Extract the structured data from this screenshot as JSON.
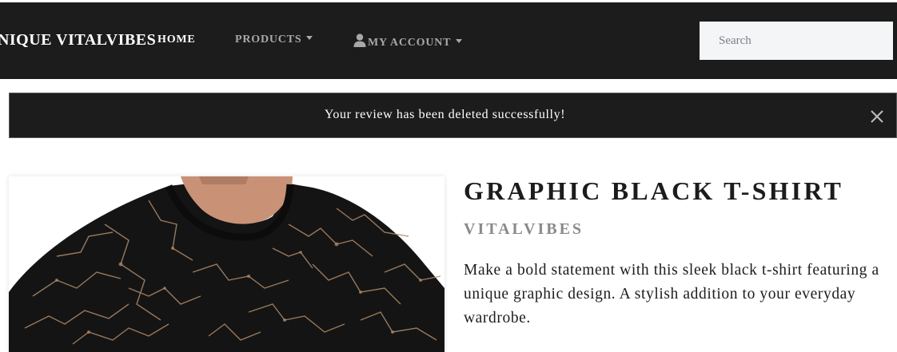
{
  "nav": {
    "brand": "UNIQUE VITALVIBES",
    "items": {
      "home": "HOME",
      "products": "PRODUCTS",
      "account": "MY ACCOUNT"
    },
    "search_placeholder": "Search",
    "background": "#1c1c1c"
  },
  "alert": {
    "message": "Your review has been deleted successfully!",
    "close_icon": "close-icon"
  },
  "product": {
    "title": "GRAPHIC BLACK T-SHIRT",
    "brand": "VITALVIBES",
    "description": "Make a bold statement with this sleek black t-shirt featuring a unique graphic design. A stylish addition to your everyday wardrobe.",
    "image": "product-photo-graphic-black-tshirt"
  }
}
